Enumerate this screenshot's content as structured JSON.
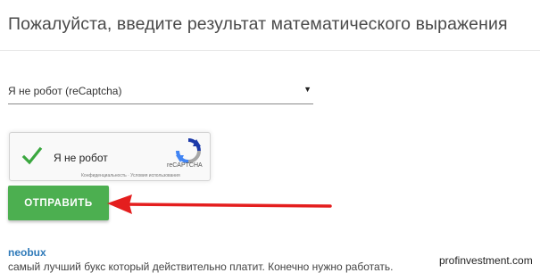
{
  "title": "Пожалуйста, введите результат математического выражения",
  "captcha_select": {
    "value": "Я не робот (reCaptcha)",
    "arrow": "▼"
  },
  "recaptcha": {
    "label": "Я не робот",
    "checked": true,
    "brand": "reCAPTCHA",
    "legal": "Конфиденциальность · Условия использования",
    "icons": {
      "check": "green-checkmark-icon",
      "logo": "recaptcha-logo-icon"
    },
    "colors": {
      "check": "#3aa73f",
      "logo_blue": "#1c3aa9",
      "logo_grey": "#a6a6a6",
      "logo_light": "#4285f4"
    }
  },
  "submit_label": "ОТПРАВИТЬ",
  "submit_color": "#4caf50",
  "annotation_arrow_color": "#e41e1e",
  "ad": {
    "name": "neobux",
    "description": "самый лучший букс который действительно платит. Конечно нужно работать."
  },
  "watermark": "profinvestment.com"
}
